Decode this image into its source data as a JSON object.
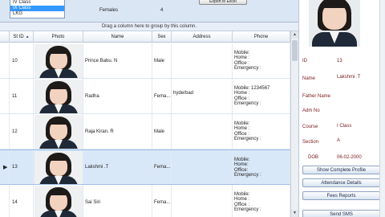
{
  "top": {
    "class_list": [
      "IV Class",
      "IX Class",
      "LKG"
    ],
    "selected_class_index": 1,
    "females_label": "Females",
    "females_count": "4",
    "export_label": "Export to Excel"
  },
  "group_panel": {
    "hint": "Drag a column here to group by this column."
  },
  "grid": {
    "columns": {
      "id": "St ID",
      "photo": "Photo",
      "name": "Name",
      "sex": "Sex",
      "address": "Address",
      "phone": "Phone"
    },
    "sort_indicator": "▲",
    "rows": [
      {
        "id": "10",
        "name": "Prince Babu. N",
        "sex": "Male",
        "address": "",
        "phone": [
          "Mobile:",
          "Home :",
          "Office :",
          "Emergency :"
        ],
        "selected": false
      },
      {
        "id": "11",
        "name": "Radha",
        "sex": "Fema...",
        "address": "hyderbad",
        "phone": [
          "Mobile: 1234567",
          "Home :",
          "Office :",
          "Emergency :"
        ],
        "selected": false
      },
      {
        "id": "12",
        "name": "Raja Kiran. R",
        "sex": "Male",
        "address": "",
        "phone": [
          "Mobile:",
          "Home :",
          "Office :",
          "Emergency :"
        ],
        "selected": false
      },
      {
        "id": "13",
        "name": "Lakshmi .T",
        "sex": "Fema...",
        "address": "",
        "phone": [
          "Mobile:",
          "Home:",
          "Office:",
          "Emergency :"
        ],
        "selected": true
      },
      {
        "id": "14",
        "name": "Sai Siri",
        "sex": "Fema...",
        "address": "",
        "phone": [
          "Mobile:",
          "Home :",
          "Office :",
          "Emergency :"
        ],
        "selected": false
      }
    ]
  },
  "detail": {
    "fields": {
      "id_label": "ID",
      "id_value": "13",
      "name_label": "Name",
      "name_value": "Lakshmi .T",
      "father_label": "Father Name",
      "father_value": "",
      "adm_label": "Adm No",
      "adm_value": "",
      "course_label": "Course",
      "course_value": "I Class",
      "section_label": "Section",
      "section_value": "A",
      "dob_label": "DOB",
      "dob_value": "06-02-2000"
    },
    "buttons": {
      "profile": "Show Complete Profile",
      "attendance": "Attendance Details",
      "fees": "Fees Reports",
      "sms": "Send SMS"
    }
  },
  "colors": {
    "selection": "#d9e8f8",
    "accent": "#3399ff",
    "label": "#7a1a1a"
  }
}
